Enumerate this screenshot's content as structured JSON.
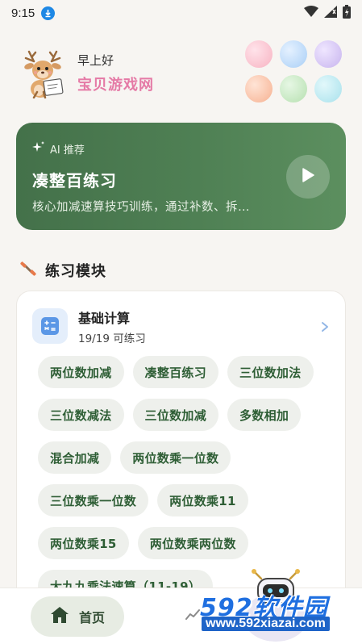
{
  "status_bar": {
    "time": "9:15"
  },
  "header": {
    "greeting": "早上好",
    "brand": "宝贝游戏网"
  },
  "ai_card": {
    "tag": "AI 推荐",
    "title": "凑整百练习",
    "description": "核心加减速算技巧训练，通过补数、拆…"
  },
  "section": {
    "title": "练习模块"
  },
  "module": {
    "name": "基础计算",
    "count": "19/19 可练习",
    "chips": [
      "两位数加减",
      "凑整百练习",
      "三位数加法",
      "三位数减法",
      "三位数加减",
      "多数相加",
      "混合加减",
      "两位数乘一位数",
      "三位数乘一位数",
      "两位数乘11",
      "两位数乘15",
      "两位数乘两位数",
      "大九九乘法速算（11-19）"
    ]
  },
  "bottom_nav": {
    "home_label": "首页"
  },
  "watermark": {
    "logo": "592软件园",
    "url": "www.592xiazai.com"
  },
  "colors": {
    "ai_card": "#4c7b51",
    "brand": "#e57aa6",
    "chip_text": "#2e5e35",
    "chip_bg": "#eef0ec",
    "accent_blue": "#1e88e5"
  }
}
